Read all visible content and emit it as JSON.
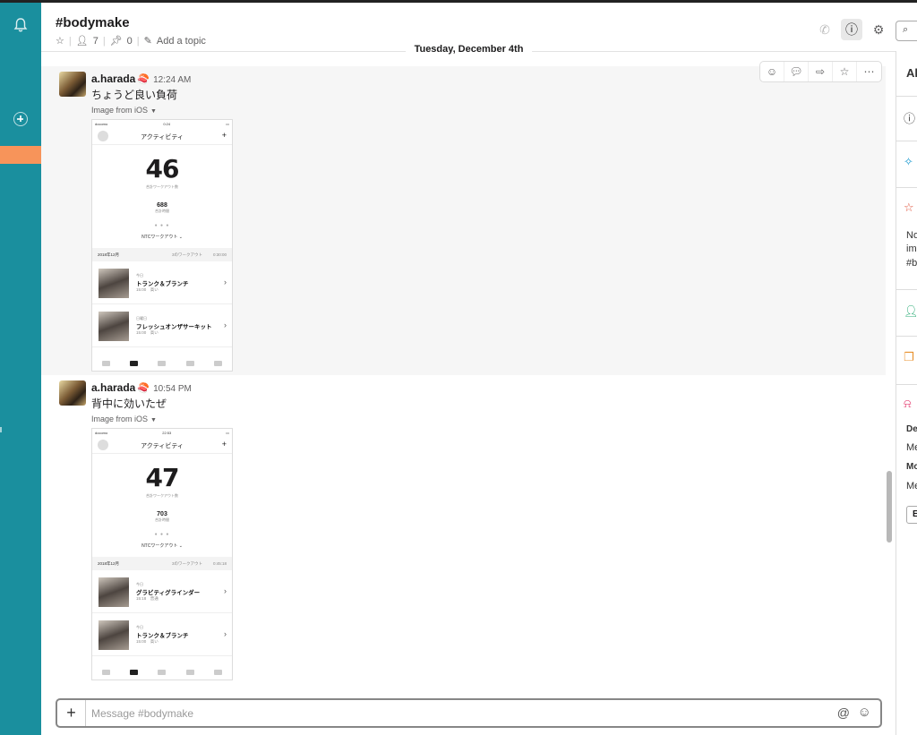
{
  "channel": {
    "name": "#bodymake",
    "members": "7",
    "pins": "0",
    "topic_link": "Add a topic"
  },
  "date_divider": "Tuesday, December 4th",
  "messages": [
    {
      "user": "a.harada",
      "time": "12:24 AM",
      "text": "ちょうど良い負荷",
      "attachment_label": "Image from iOS",
      "phone": {
        "carrier": "docomo",
        "clock": "0:24",
        "title": "アクティビティ",
        "count": "46",
        "count_label": "合計ワークアウト数",
        "minutes": "688",
        "minutes_label": "合計時間",
        "ntc": "NTCワークアウト",
        "month": "2018年12月",
        "month_workouts": "3のワークアウト",
        "month_time": "0:30:00",
        "items": [
          {
            "day": "今日",
            "name": "トランク＆ブランチ",
            "detail": "15:00　高い"
          },
          {
            "day": "日曜日",
            "name": "フレッシュオンザサーキット",
            "detail": "15:00　高い"
          }
        ]
      }
    },
    {
      "user": "a.harada",
      "time": "10:54 PM",
      "text": "背中に効いたぜ",
      "attachment_label": "Image from iOS",
      "phone": {
        "carrier": "docomo",
        "clock": "22:53",
        "title": "アクティビティ",
        "count": "47",
        "count_label": "合計ワークアウト数",
        "minutes": "703",
        "minutes_label": "合計時間",
        "ntc": "NTCワークアウト",
        "month": "2018年12月",
        "month_workouts": "3のワークアウト",
        "month_time": "0:45:18",
        "items": [
          {
            "day": "今日",
            "name": "グラビティグラインダー",
            "detail": "15:18　普通"
          },
          {
            "day": "今日",
            "name": "トランク＆ブランチ",
            "detail": "15:00　高い"
          }
        ]
      }
    }
  ],
  "composer": {
    "placeholder": "Message #bodymake"
  },
  "panel": {
    "title_fragment": "Al",
    "text_1": "No",
    "text_2": "im",
    "text_3": "#b",
    "label_1": "De",
    "value_1": "Me",
    "label_2": "Mo",
    "value_2": "Me",
    "button": "E"
  },
  "colors": {
    "rail": "#1a8f9e",
    "active_channel": "#f7945a",
    "hover_bg": "#f6f6f6"
  }
}
